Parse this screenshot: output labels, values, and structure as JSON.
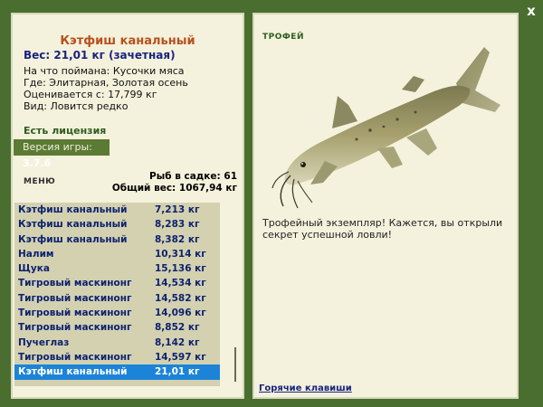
{
  "close_label": "x",
  "fish": {
    "title": "Кэтфиш канальный",
    "weight": "Вес: 21,01 кг (зачетная)",
    "bait": "На что поймана: Кусочки мяса",
    "location": "Где: Элитарная, Золотая осень",
    "value": "Оценивается с: 17,799 кг",
    "kind": "Вид: Ловится редко"
  },
  "license": "Есть лицензия",
  "version": {
    "label": "Версия игры:",
    "value": "3.7.6"
  },
  "menu_label": "МЕНЮ",
  "stats": {
    "fish_count": "Рыб в садке: 61",
    "total_weight": "Общий вес: 1067,94 кг"
  },
  "catch_list": [
    {
      "name": "Кэтфиш канальный",
      "weight": "7,213 кг"
    },
    {
      "name": "Кэтфиш канальный",
      "weight": "8,283 кг"
    },
    {
      "name": "Кэтфиш канальный",
      "weight": "8,382 кг"
    },
    {
      "name": "Налим",
      "weight": "10,314 кг"
    },
    {
      "name": "Щука",
      "weight": "15,136 кг"
    },
    {
      "name": "Тигровый маскинонг",
      "weight": "14,534 кг"
    },
    {
      "name": "Тигровый маскинонг",
      "weight": "14,582 кг"
    },
    {
      "name": "Тигровый маскинонг",
      "weight": "14,096 кг"
    },
    {
      "name": "Тигровый маскинонг",
      "weight": "8,852 кг"
    },
    {
      "name": "Пучеглаз",
      "weight": "8,142 кг"
    },
    {
      "name": "Тигровый маскинонг",
      "weight": "14,597 кг"
    },
    {
      "name": "Кэтфиш канальный",
      "weight": "21,01 кг",
      "selected": true
    }
  ],
  "trophy": {
    "label": "ТРОФЕЙ",
    "text": "Трофейный экземпляр! Кажется, вы открыли секрет успешной ловли!"
  },
  "hotkeys": "Горячие клавиши",
  "colors": {
    "background": "#4a6e2f",
    "panel": "#f4f2dc",
    "title": "#b8501d",
    "list_text": "#0d2270",
    "selected": "#1c84d8"
  }
}
